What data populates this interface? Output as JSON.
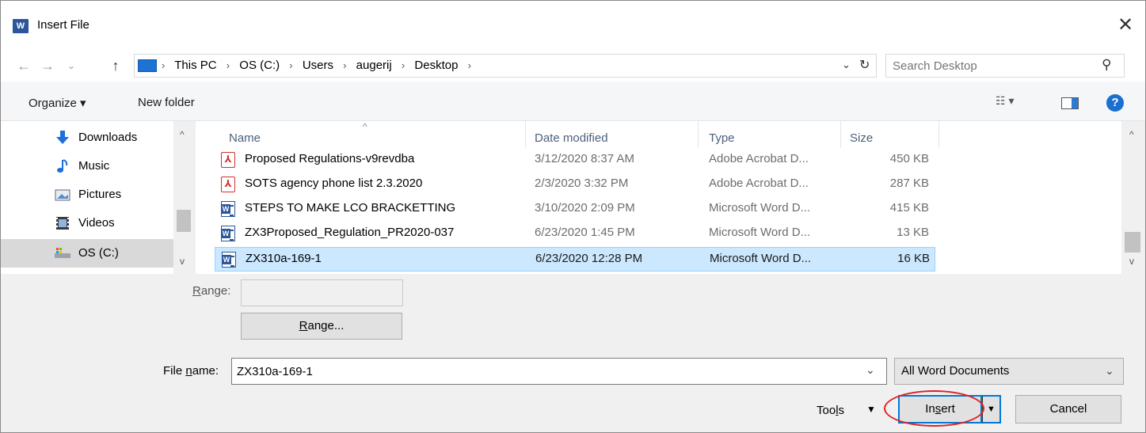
{
  "window": {
    "title": "Insert File",
    "app_icon": "W",
    "close_label": "✕"
  },
  "address": {
    "crumbs": [
      "This PC",
      "OS (C:)",
      "Users",
      "augerij",
      "Desktop"
    ],
    "search_placeholder": "Search Desktop"
  },
  "toolbar": {
    "organize_label": "Organize ▾",
    "new_folder_label": "New folder"
  },
  "nav": {
    "items": [
      {
        "label": "Downloads",
        "icon": "download-icon"
      },
      {
        "label": "Music",
        "icon": "music-icon"
      },
      {
        "label": "Pictures",
        "icon": "pictures-icon"
      },
      {
        "label": "Videos",
        "icon": "videos-icon"
      },
      {
        "label": "OS (C:)",
        "icon": "drive-icon",
        "selected": true
      }
    ]
  },
  "filelist": {
    "columns": [
      "Name",
      "Date modified",
      "Type",
      "Size"
    ],
    "rows": [
      {
        "name": "Proposed Regulations-v9revdba",
        "date": "3/12/2020 8:37 AM",
        "type": "Adobe Acrobat D...",
        "size": "450 KB",
        "icon": "pdf-icon"
      },
      {
        "name": "SOTS agency phone list 2.3.2020",
        "date": "2/3/2020 3:32 PM",
        "type": "Adobe Acrobat D...",
        "size": "287 KB",
        "icon": "pdf-icon"
      },
      {
        "name": "STEPS TO MAKE LCO BRACKETTING",
        "date": "3/10/2020 2:09 PM",
        "type": "Microsoft Word D...",
        "size": "415 KB",
        "icon": "word-doc-icon"
      },
      {
        "name": "ZX3Proposed_Regulation_PR2020-037",
        "date": "6/23/2020 1:45 PM",
        "type": "Microsoft Word D...",
        "size": "13 KB",
        "icon": "word-doc-icon"
      },
      {
        "name": "ZX310a-169-1",
        "date": "6/23/2020 12:28 PM",
        "type": "Microsoft Word D...",
        "size": "16 KB",
        "icon": "word-doc-icon",
        "selected": true
      }
    ]
  },
  "bottom": {
    "range_label_pre": "",
    "range_label_u": "R",
    "range_label_post": "ange:",
    "range_button_u": "R",
    "range_button_post": "ange...",
    "file_name_label_pre": "File ",
    "file_name_label_u": "n",
    "file_name_label_post": "ame:",
    "file_name_value": "ZX310a-169-1",
    "file_type_value": "All Word Documents",
    "tools_pre": "Too",
    "tools_u": "l",
    "tools_post": "s",
    "insert_pre": "In",
    "insert_u": "s",
    "insert_post": "ert",
    "cancel_label": "Cancel"
  },
  "colors": {
    "accent": "#0078d7",
    "selection": "#cce8ff",
    "highlight_annotation": "#e02020"
  }
}
